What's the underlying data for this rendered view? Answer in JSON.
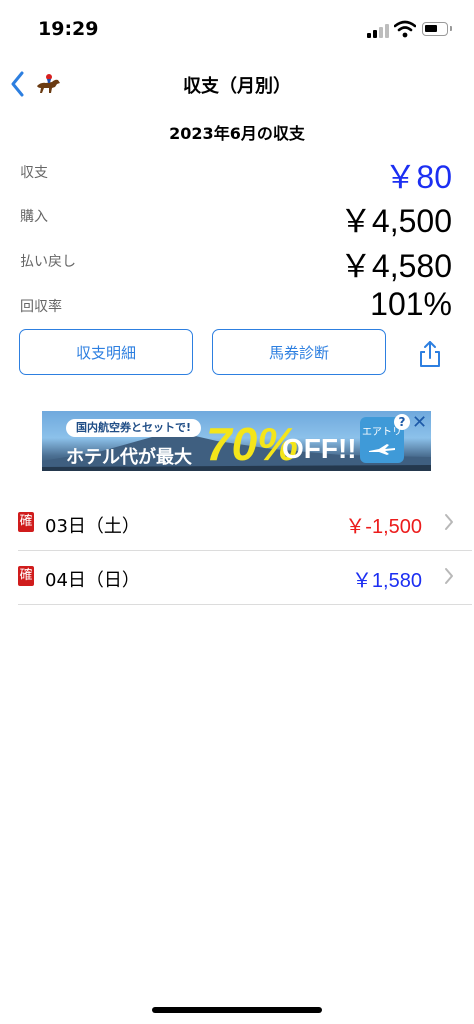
{
  "status_bar": {
    "time": "19:29"
  },
  "nav": {
    "title": "収支（月別）"
  },
  "summary": {
    "month_title": "2023年6月の収支",
    "rows": [
      {
        "label": "収支",
        "value": "￥80",
        "color": "#1c2ff2"
      },
      {
        "label": "購入",
        "value": "￥4,500",
        "color": "#000000"
      },
      {
        "label": "払い戻し",
        "value": "￥4,580",
        "color": "#000000"
      },
      {
        "label": "回収率",
        "value": "101%",
        "color": "#000000"
      }
    ]
  },
  "actions": {
    "detail_label": "収支明細",
    "diagnosis_label": "馬券診断"
  },
  "ad": {
    "pill": "国内航空券とセットで!",
    "main": "ホテル代が最大",
    "discount": "70%",
    "off": "OFF!!",
    "logo": "エアトリ"
  },
  "days": [
    {
      "badge": "確",
      "date": "03日（土）",
      "amount": "￥-1,500",
      "color": "#ec1c1c"
    },
    {
      "badge": "確",
      "date": "04日（日）",
      "amount": "￥1,580",
      "color": "#1c2ff2"
    }
  ],
  "colors": {
    "accent": "#2d7fe0",
    "positive": "#1c2ff2",
    "negative": "#ec1c1c"
  },
  "icons": [
    "back-chevron-icon",
    "horse-icon",
    "share-icon",
    "chevron-right-icon",
    "signal-icon",
    "wifi-icon",
    "battery-icon"
  ]
}
